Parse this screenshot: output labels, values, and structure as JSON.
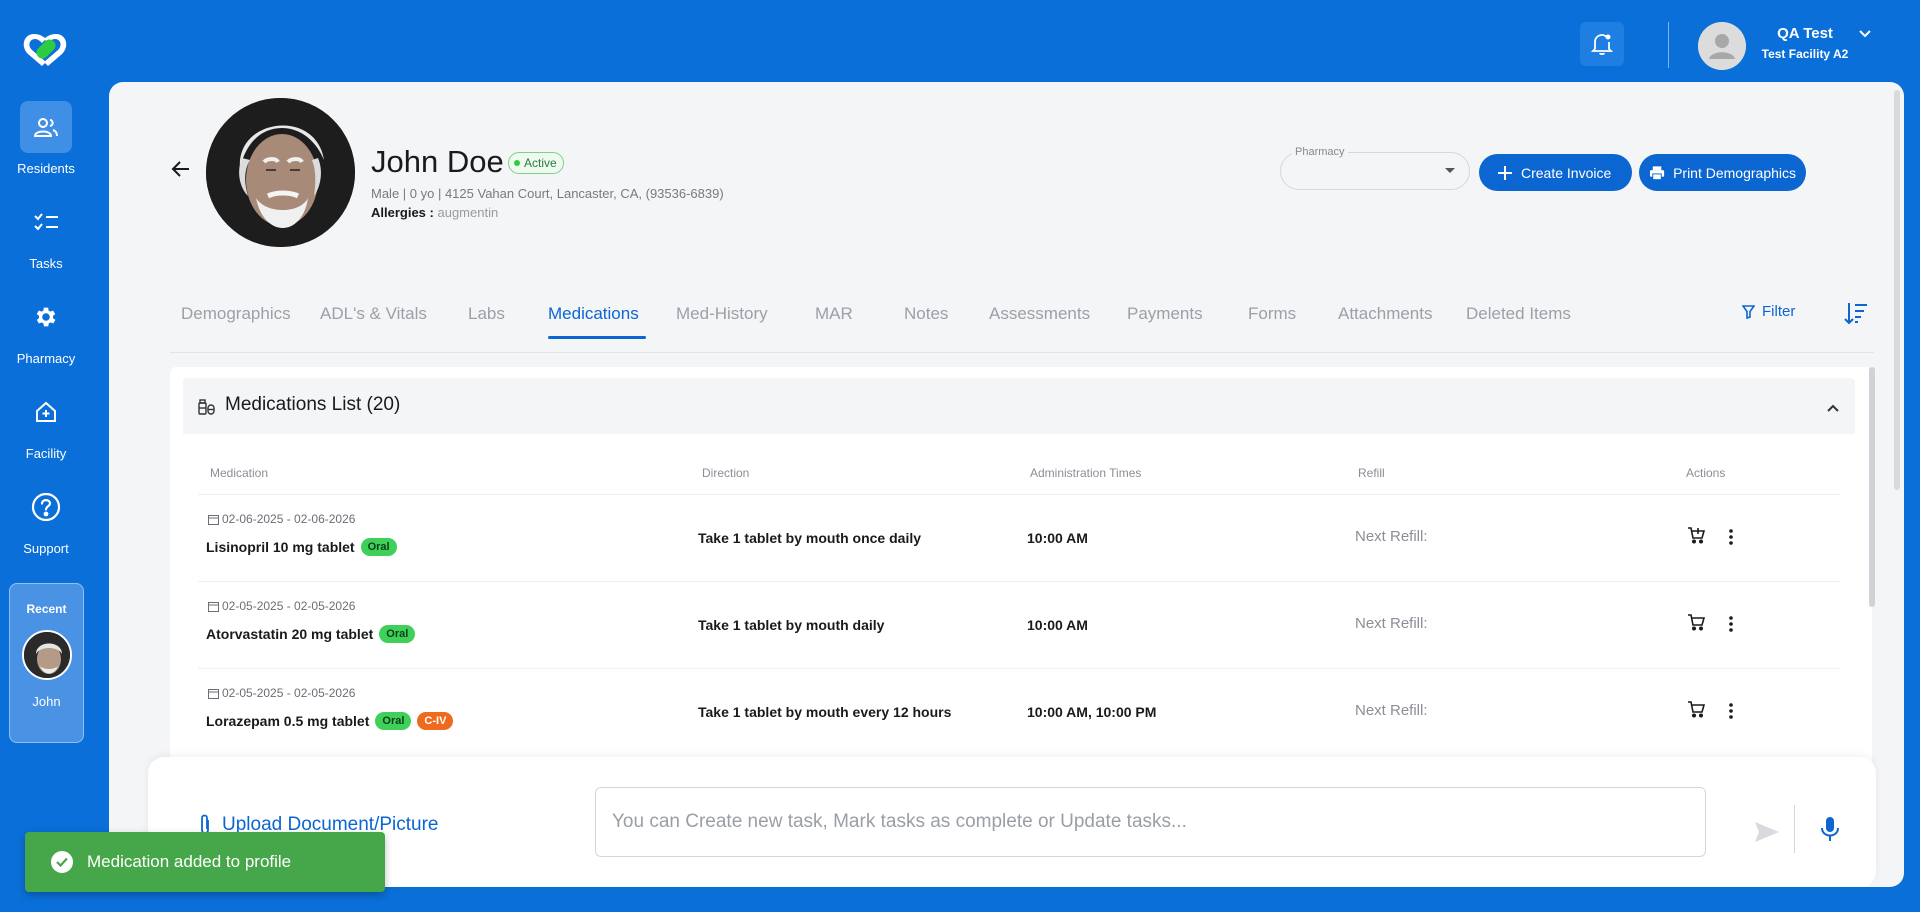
{
  "sidebar": {
    "items": [
      {
        "label": "Residents",
        "icon": "residents-icon",
        "active": true
      },
      {
        "label": "Tasks",
        "icon": "tasks-icon"
      },
      {
        "label": "Pharmacy",
        "icon": "gear-icon"
      },
      {
        "label": "Facility",
        "icon": "facility-icon"
      },
      {
        "label": "Support",
        "icon": "help-icon"
      }
    ],
    "recent": {
      "title": "Recent",
      "name": "John"
    }
  },
  "topbar": {
    "user_name": "QA Test",
    "facility": "Test Facility A2"
  },
  "patient": {
    "name": "John Doe",
    "status": "Active",
    "details": "Male | 0 yo | 4125 Vahan Court, Lancaster, CA, (93536-6839)",
    "allergies_label": "Allergies :",
    "allergies_value": "augmentin"
  },
  "actions": {
    "pharmacy_label": "Pharmacy",
    "pharmacy_value": "",
    "create_invoice": "Create Invoice",
    "print_demographics": "Print Demographics"
  },
  "tabs": [
    {
      "label": "Demographics"
    },
    {
      "label": "ADL's & Vitals"
    },
    {
      "label": "Labs"
    },
    {
      "label": "Medications",
      "active": true
    },
    {
      "label": "Med-History"
    },
    {
      "label": "MAR"
    },
    {
      "label": "Notes"
    },
    {
      "label": "Assessments"
    },
    {
      "label": "Payments"
    },
    {
      "label": "Forms"
    },
    {
      "label": "Attachments"
    },
    {
      "label": "Deleted Items"
    }
  ],
  "filter_label": "Filter",
  "medications": {
    "title": "Medications List (20)",
    "columns": [
      "Medication",
      "Direction",
      "Administration Times",
      "Refill",
      "Actions"
    ],
    "rows": [
      {
        "dates": "02-06-2025 - 02-06-2026",
        "name": "Lisinopril 10 mg tablet",
        "badges": [
          "Oral"
        ],
        "direction": "Take 1 tablet by mouth once daily",
        "times": "10:00 AM",
        "refill": "Next Refill:"
      },
      {
        "dates": "02-05-2025 - 02-05-2026",
        "name": "Atorvastatin 20 mg tablet",
        "badges": [
          "Oral"
        ],
        "direction": "Take 1 tablet by mouth daily",
        "times": "10:00 AM",
        "refill": "Next Refill:"
      },
      {
        "dates": "02-05-2025 - 02-05-2026",
        "name": "Lorazepam 0.5 mg tablet",
        "badges": [
          "Oral",
          "C-IV"
        ],
        "direction": "Take 1 tablet by mouth every 12 hours",
        "times": "10:00 AM, 10:00 PM",
        "refill": "Next Refill:"
      }
    ]
  },
  "command_bar": {
    "upload_label": "Upload Document/Picture",
    "input_placeholder": "You can Create new task, Mark tasks as complete or Update tasks...",
    "input_value": ""
  },
  "toast": {
    "message": "Medication added to profile"
  },
  "colors": {
    "brand": "#0a6fd8",
    "primary": "#0b66d2",
    "oral_badge": "#3fd05a",
    "civ_badge": "#ef6a1e",
    "toast": "#46a74a"
  }
}
